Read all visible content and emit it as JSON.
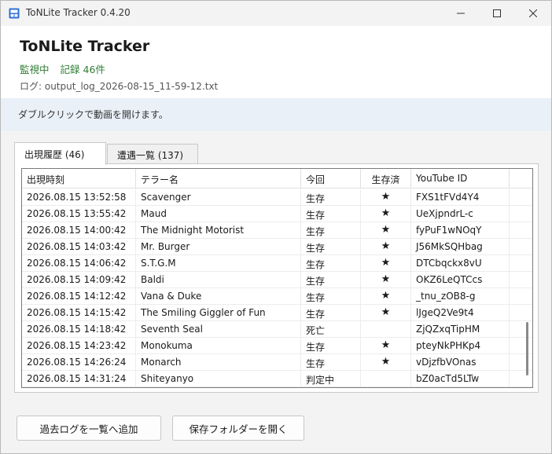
{
  "window": {
    "title": "ToNLite Tracker 0.4.20",
    "minimize_glyph": "—",
    "maximize_glyph": "☐",
    "close_glyph": "✕"
  },
  "header": {
    "app_title": "ToNLite Tracker",
    "status_monitoring": "監視中",
    "status_records": "記録 46件",
    "log_file": "ログ: output_log_2026-08-15_11-59-12.txt"
  },
  "hint": {
    "text": "ダブルクリックで動画を開けます。"
  },
  "tabs": [
    {
      "label": "出現履歴 (46)",
      "active": true
    },
    {
      "label": "遭遇一覧 (137)",
      "active": false
    }
  ],
  "table": {
    "columns": [
      "出現時刻",
      "テラー名",
      "今回",
      "生存済",
      "YouTube ID"
    ],
    "rows": [
      {
        "time": "2026.08.15 13:52:58",
        "terror": "Scavenger",
        "round": "生存",
        "survived": "★",
        "youtube_id": "FXS1tFVd4Y4"
      },
      {
        "time": "2026.08.15 13:55:42",
        "terror": "Maud",
        "round": "生存",
        "survived": "★",
        "youtube_id": "UeXjpndrL-c"
      },
      {
        "time": "2026.08.15 14:00:42",
        "terror": "The Midnight Motorist",
        "round": "生存",
        "survived": "★",
        "youtube_id": "fyPuF1wNOqY"
      },
      {
        "time": "2026.08.15 14:03:42",
        "terror": "Mr. Burger",
        "round": "生存",
        "survived": "★",
        "youtube_id": "J56MkSQHbag"
      },
      {
        "time": "2026.08.15 14:06:42",
        "terror": "S.T.G.M",
        "round": "生存",
        "survived": "★",
        "youtube_id": "DTCbqckx8vU"
      },
      {
        "time": "2026.08.15 14:09:42",
        "terror": "Baldi",
        "round": "生存",
        "survived": "★",
        "youtube_id": "OKZ6LeQTCcs"
      },
      {
        "time": "2026.08.15 14:12:42",
        "terror": "Vana & Duke",
        "round": "生存",
        "survived": "★",
        "youtube_id": "_tnu_zOB8-g"
      },
      {
        "time": "2026.08.15 14:15:42",
        "terror": "The Smiling Giggler of Fun",
        "round": "生存",
        "survived": "★",
        "youtube_id": "lJgeQ2Ve9t4"
      },
      {
        "time": "2026.08.15 14:18:42",
        "terror": "Seventh Seal",
        "round": "死亡",
        "survived": "",
        "youtube_id": "ZjQZxqTipHM"
      },
      {
        "time": "2026.08.15 14:23:42",
        "terror": "Monokuma",
        "round": "生存",
        "survived": "★",
        "youtube_id": "pteyNkPHKp4"
      },
      {
        "time": "2026.08.15 14:26:24",
        "terror": "Monarch",
        "round": "生存",
        "survived": "★",
        "youtube_id": "vDjzfbVOnas"
      },
      {
        "time": "2026.08.15 14:31:24",
        "terror": "Shiteyanyo",
        "round": "判定中",
        "survived": "",
        "youtube_id": "bZ0acTd5LTw"
      }
    ]
  },
  "buttons": {
    "add_past_logs": "過去ログを一覧へ追加",
    "open_save_folder": "保存フォルダーを開く"
  },
  "colors": {
    "status_green": "#2e7d32",
    "hint_background": "#e9f0f8",
    "icon_blue": "#2f6fd6"
  }
}
